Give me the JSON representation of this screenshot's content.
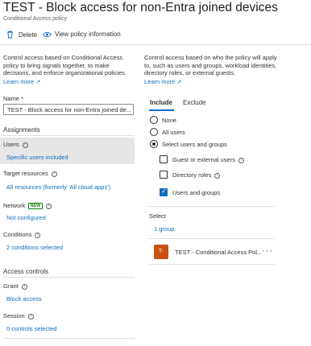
{
  "header": {
    "title": "TEST - Block access for non-Entra joined devices",
    "subtitle": "Conditional Access policy",
    "more_glyph": "···"
  },
  "toolbar": {
    "delete_label": "Delete",
    "view_info_label": "View policy information"
  },
  "left": {
    "description": "Control access based on Conditional Access policy to bring signals together, to make decisions, and enforce organizational policies.",
    "learn_more": "Learn more",
    "name_label": "Name *",
    "name_value": "TEST - Block access for non-Entra joined de...",
    "assignments_heading": "Assignments",
    "users_label": "Users",
    "users_value": "Specific users included",
    "target_label": "Target resources",
    "target_value": "All resources (formerly 'All cloud apps')",
    "network_label": "Network",
    "network_badge": "NEW",
    "network_value": "Not configured",
    "conditions_label": "Conditions",
    "conditions_value": "2 conditions selected",
    "access_heading": "Access controls",
    "grant_label": "Grant",
    "grant_value": "Block access",
    "session_label": "Session",
    "session_value": "0 controls selected"
  },
  "right": {
    "description": "Control access based on who the policy will apply to, such as users and groups, workload identities, directory roles, or external guests.",
    "learn_more": "Learn more",
    "tabs": [
      "Include",
      "Exclude"
    ],
    "radio_none": "None",
    "radio_all": "All users",
    "radio_select": "Select users and groups",
    "cb_guest": "Guest or external users",
    "cb_roles": "Directory roles",
    "cb_users": "Users and groups",
    "select_label": "Select",
    "select_value": "1 group",
    "group_initials": "T-",
    "group_name": "TEST - Conditional Access Pol...",
    "group_more": "···"
  },
  "colors": {
    "accent": "#0f6cbd",
    "avatar": "#ca5010",
    "selected_row": "#e6e6e6",
    "new_badge": "#107c10"
  },
  "icons": {
    "delete": "trash-icon",
    "view_info": "eye-icon",
    "info": "info-icon",
    "external": "external-link-icon"
  }
}
